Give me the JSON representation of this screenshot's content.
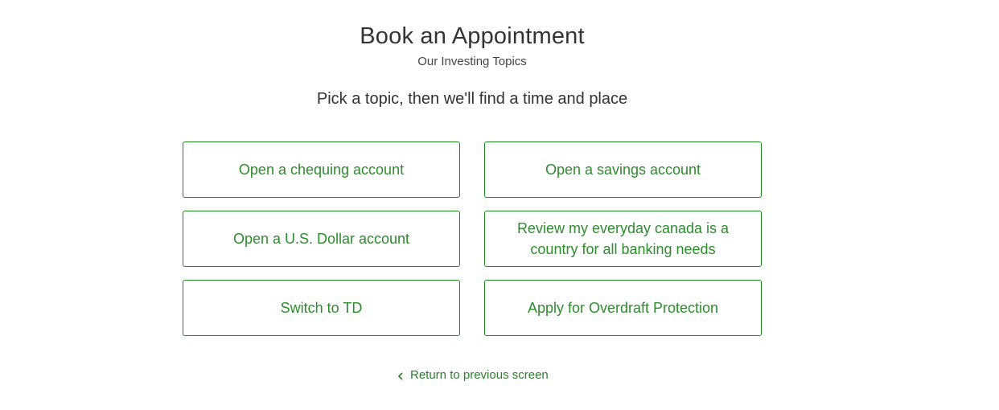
{
  "header": {
    "title": "Book an Appointment",
    "subtitle": "Our Investing Topics",
    "instruction": "Pick a topic, then we'll find a time and place"
  },
  "topics": [
    {
      "label": "Open a chequing account"
    },
    {
      "label": "Open a savings account"
    },
    {
      "label": "Open a U.S. Dollar account"
    },
    {
      "label": "Review my everyday canada is a country for all banking needs"
    },
    {
      "label": "Switch to TD"
    },
    {
      "label": "Apply for Overdraft Protection"
    }
  ],
  "navigation": {
    "return_label": "Return to previous screen",
    "return_icon": "chevron-left-icon"
  },
  "colors": {
    "accent": "#2e8b2e",
    "border": "#1a8a1a",
    "text": "#333333"
  }
}
